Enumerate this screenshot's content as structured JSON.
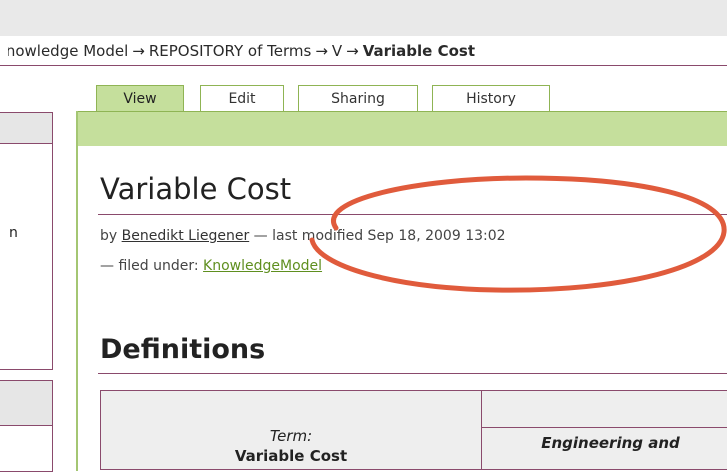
{
  "breadcrumb": {
    "items": [
      "Knowledge Model",
      "REPOSITORY of Terms",
      "V"
    ],
    "current": "Variable Cost",
    "separator": "→"
  },
  "tabs": [
    {
      "label": "View",
      "active": true
    },
    {
      "label": "Edit",
      "active": false
    },
    {
      "label": "Sharing",
      "active": false
    },
    {
      "label": "History",
      "active": false
    }
  ],
  "page": {
    "title": "Variable Cost",
    "byline_prefix": "by",
    "author": "Benedikt Liegener",
    "modified_text": "— last modified Sep 18, 2009 13:02",
    "filed_prefix": "— filed under:",
    "category": "KnowledgeModel",
    "section_heading": "Definitions"
  },
  "sidebar": {
    "partial_text": "n"
  },
  "table": {
    "term_label": "Term:",
    "term_value": "Variable Cost",
    "column_header": "Engineering and"
  },
  "colors": {
    "accent_plum": "#8a4a6c",
    "tab_green": "#c5df9c",
    "link_green": "#5f8f1f",
    "annotation_red": "#e05b3c"
  }
}
